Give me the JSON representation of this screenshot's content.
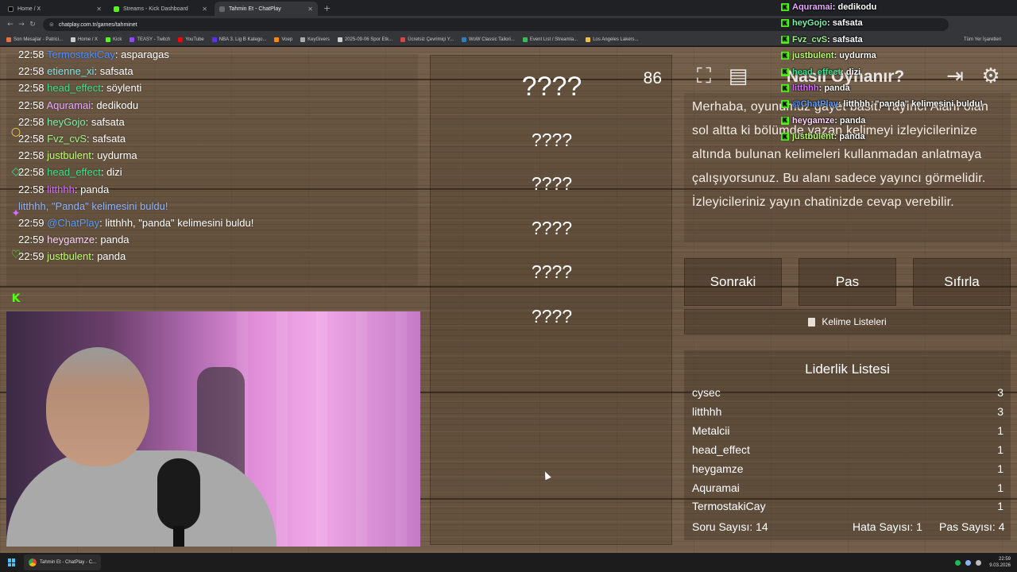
{
  "browser": {
    "tabs": [
      {
        "title": "Home / X",
        "favicon_color": "#000000",
        "active": false
      },
      {
        "title": "Streams - Kick Dashboard",
        "favicon_color": "#53fc18",
        "active": false
      },
      {
        "title": "Tahmin Et - ChatPlay",
        "favicon_color": "#444444",
        "active": true
      }
    ],
    "url": "chatplay.com.tr/games/tahminet",
    "bookmarks": [
      "Son Mesajlar - Patrici...",
      "Home / X",
      "Kick",
      "TEASY - Twitch",
      "YouTube",
      "NBA 3. Lig B Katego...",
      "Voep",
      "KeyGivers",
      "2025-09-06 Spor Etk...",
      "Ücretsiz Çevrimiçi Y...",
      "WoW Classic Tailori...",
      "Event List / Streamla...",
      "Los Angeles Lakers..."
    ],
    "bookmarks_right": "Tüm Yer İşaretleri"
  },
  "chat": [
    {
      "time": "22:58",
      "user": "TermostakiCay",
      "color": "#4a8cff",
      "message": "asparagas"
    },
    {
      "time": "22:58",
      "user": "etienne_xi",
      "color": "#7de3e8",
      "message": "safsata"
    },
    {
      "time": "22:58",
      "user": "head_effect",
      "color": "#39e08a",
      "message": "söylenti"
    },
    {
      "time": "22:58",
      "user": "Aquramai",
      "color": "#e6a8ff",
      "message": "dedikodu"
    },
    {
      "time": "22:58",
      "user": "heyGojo",
      "color": "#7cf0a8",
      "message": "safsata"
    },
    {
      "time": "22:58",
      "user": "Fvz_cvS",
      "color": "#9ef08a",
      "message": "safsata"
    },
    {
      "time": "22:58",
      "user": "justbulent",
      "color": "#b8ff6a",
      "message": "uydurma"
    },
    {
      "time": "22:58",
      "user": "head_effect",
      "color": "#39e08a",
      "message": "dizi"
    },
    {
      "time": "22:58",
      "user": "litthhh",
      "color": "#d46cff",
      "message": "panda"
    },
    {
      "time": "",
      "user": "",
      "color": "#8fb4ff",
      "message": "litthhh, \"Panda\" kelimesini buldu!"
    },
    {
      "time": "22:59",
      "user": "@ChatPlay",
      "color": "#5a9cff",
      "message": "litthhh, \"panda\" kelimesini buldu!"
    },
    {
      "time": "22:59",
      "user": "heygamze",
      "color": "#ffd4ff",
      "message": "panda"
    },
    {
      "time": "22:59",
      "user": "justbulent",
      "color": "#b8ff6a",
      "message": "panda"
    }
  ],
  "game": {
    "timer": "86",
    "main_word": "????",
    "forbidden_words": [
      "????",
      "????",
      "????",
      "????",
      "????"
    ],
    "howto_title": "Nasıl Oynanır?",
    "description": "Merhaba, oyunumuz gayet basit. Yayıncı Alanı olan sol altta ki bölümde yazan kelimeyi izleyicilerinize altında bulunan kelimeleri kullanmadan anlatmaya çalışıyorsunuz. Bu alanı sadece yayıncı görmelidir. İzleyicileriniz yayın chatinizde cevap verebilir.",
    "buttons": {
      "next": "Sonraki",
      "pass": "Pas",
      "reset": "Sıfırla"
    },
    "word_lists_label": "Kelime Listeleri",
    "leaderboard_title": "Liderlik Listesi",
    "leaderboard": [
      {
        "name": "cysec",
        "score": "3"
      },
      {
        "name": "litthhh",
        "score": "3"
      },
      {
        "name": "Metalcii",
        "score": "1"
      },
      {
        "name": "head_effect",
        "score": "1"
      },
      {
        "name": "heygamze",
        "score": "1"
      },
      {
        "name": "Aquramai",
        "score": "1"
      },
      {
        "name": "TermostakiCay",
        "score": "1"
      }
    ],
    "stats": {
      "questions": "Soru Sayısı: 14",
      "errors": "Hata Sayısı: 1",
      "passes": "Pas Sayısı: 4"
    }
  },
  "kick_overlay": [
    {
      "user": "Aquramai",
      "color": "#e6a8ff",
      "message": ": dedikodu"
    },
    {
      "user": "heyGojo",
      "color": "#7cf0a8",
      "message": ": safsata"
    },
    {
      "user": "Fvz_cvS",
      "color": "#9ef08a",
      "message": ": safsata"
    },
    {
      "user": "justbulent",
      "color": "#b8ff6a",
      "message": ": uydurma"
    },
    {
      "user": "head_effect",
      "color": "#39e08a",
      "message": ": dizi"
    },
    {
      "user": "litthhh",
      "color": "#d46cff",
      "message": ": panda"
    },
    {
      "user": "@ChatPlay",
      "color": "#5a9cff",
      "message": ": litthhh, \"panda\" kelimesini buldu!"
    },
    {
      "user": "heygamze",
      "color": "#ffd4ff",
      "message": ": panda"
    },
    {
      "user": "justbulent",
      "color": "#b8ff6a",
      "message": ": panda"
    }
  ],
  "taskbar": {
    "app_label": "Tahmin Et - ChatPlay - C...",
    "time": "22:59",
    "date": "9.03.2026"
  }
}
